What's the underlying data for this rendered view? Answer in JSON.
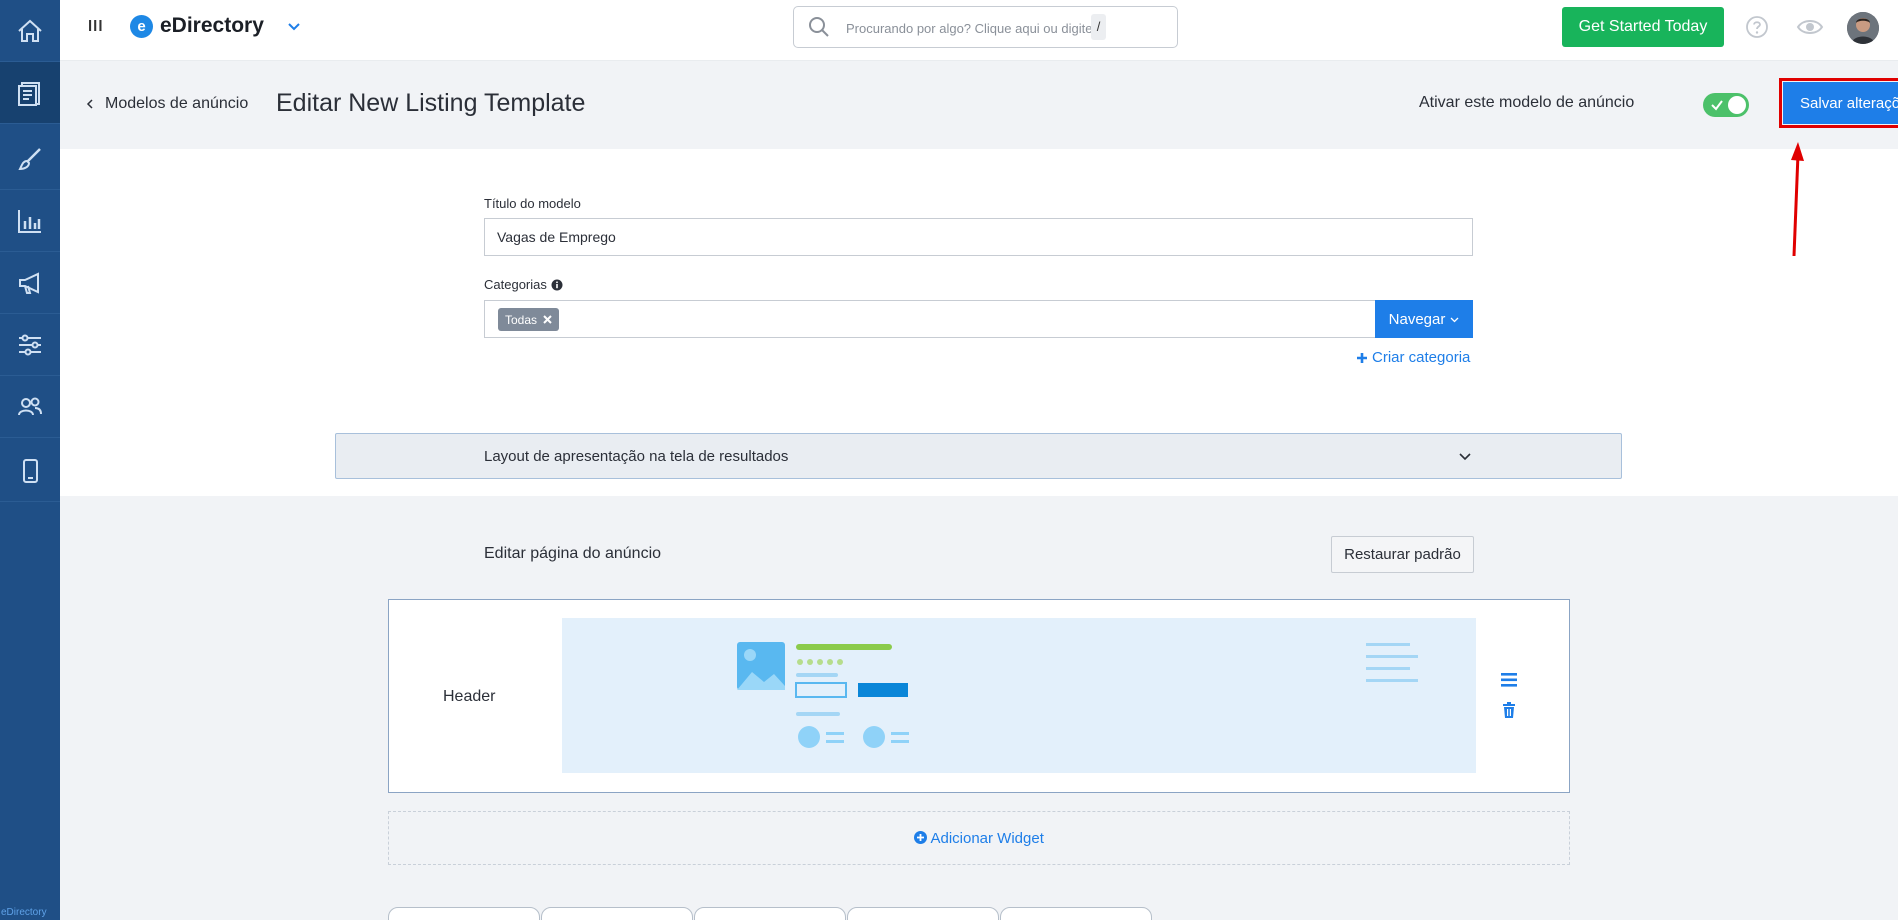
{
  "brand": {
    "name": "eDirectory",
    "mark": "e",
    "footer_text": "eDirectory"
  },
  "sidebar": {
    "items": [
      {
        "icon": "home-icon"
      },
      {
        "icon": "listings-icon",
        "active": true
      },
      {
        "icon": "brush-icon"
      },
      {
        "icon": "chart-icon"
      },
      {
        "icon": "megaphone-icon"
      },
      {
        "icon": "sliders-icon"
      },
      {
        "icon": "users-icon"
      },
      {
        "icon": "mobile-icon"
      }
    ]
  },
  "topbar": {
    "search_placeholder": "Procurando por algo? Clique aqui ou digite",
    "search_shortcut": "/",
    "get_started_label": "Get Started Today"
  },
  "subheader": {
    "back_label": "Modelos de anúncio",
    "title": "Editar New Listing Template",
    "toggle_label": "Ativar este modelo de anúncio",
    "toggle_on": true,
    "save_label": "Salvar alterações"
  },
  "form": {
    "title_label": "Título do modelo",
    "title_value": "Vagas de Emprego",
    "categories_label": "Categorias",
    "category_tag": "Todas",
    "browse_label": "Navegar",
    "create_category_label": "Criar categoria"
  },
  "accordion": {
    "label": "Layout de apresentação na tela de resultados"
  },
  "editor": {
    "label": "Editar página do anúncio",
    "restore_label": "Restaurar padrão",
    "widget_label": "Header",
    "add_widget_label": "Adicionar Widget"
  },
  "colors": {
    "sidebar": "#1f4f86",
    "accent": "#1e7ee8",
    "success": "#18b45b",
    "annotation": "#e00000"
  }
}
